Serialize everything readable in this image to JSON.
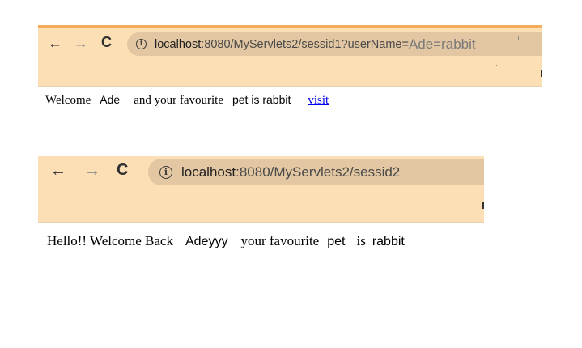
{
  "screen1": {
    "toolbar": {
      "back_icon": "arrow-left-icon",
      "forward_icon": "arrow-right-icon",
      "reload_icon": "reload-icon",
      "back_glyph": "←",
      "forward_glyph": "→",
      "reload_glyph": "C"
    },
    "address": {
      "info_icon": "info-icon",
      "info_glyph": "i",
      "host": "localhost",
      "path": ":8080/MyServlets2/sessid1?userName=",
      "extra": " Ade=rabbit"
    },
    "page": {
      "welcome": "Welcome",
      "name": "Ade",
      "and_fav": "and your favourite",
      "pet_text": "pet is rabbit",
      "link": "visit"
    }
  },
  "screen2": {
    "toolbar": {
      "back_icon": "arrow-left-icon",
      "forward_icon": "arrow-right-icon",
      "reload_icon": "reload-icon",
      "back_glyph": "←",
      "forward_glyph": "→",
      "reload_glyph": "C"
    },
    "address": {
      "info_icon": "info-icon",
      "info_glyph": "i",
      "host": "localhost",
      "path": ":8080/MyServlets2/sessid2"
    },
    "page": {
      "hello": "Hello!! Welcome Back",
      "name": "Adeyyy",
      "your_fav": "your favourite",
      "pet": "pet",
      "is": "is",
      "animal": "rabbit"
    }
  },
  "colors": {
    "toolbar_bg": "#fddfb6",
    "address_bg": "#e2c7a2",
    "top_border": "#f3ad5b",
    "link": "#0000ee"
  }
}
